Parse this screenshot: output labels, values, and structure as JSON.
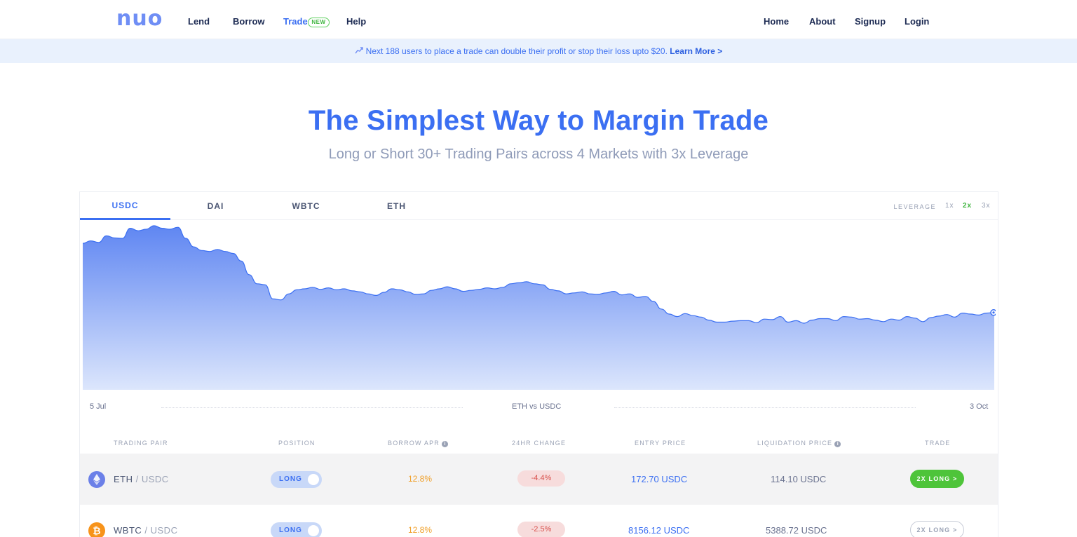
{
  "nav": {
    "logo": "nuo",
    "links": [
      "Lend",
      "Borrow",
      "Trade",
      "Help"
    ],
    "new_badge": "NEW",
    "right_links": [
      "Home",
      "About",
      "Signup",
      "Login"
    ]
  },
  "banner": {
    "icon": "rocket-icon",
    "text": "Next 188 users to place a trade can double their profit or stop their loss upto $20.",
    "link": "Learn More >"
  },
  "hero": {
    "title": "The Simplest Way to Margin Trade",
    "subtitle": "Long or Short 30+ Trading Pairs across 4 Markets with 3x Leverage"
  },
  "market": {
    "tabs": [
      "USDC",
      "DAI",
      "WBTC",
      "ETH"
    ],
    "active_tab": "USDC",
    "leverage_label": "LEVERAGE",
    "leverage_options": [
      "1x",
      "2x",
      "3x"
    ],
    "active_leverage": "2x"
  },
  "chart_data": {
    "type": "area",
    "title": "ETH vs USDC",
    "x_start_label": "5 Jul",
    "x_end_label": "3 Oct",
    "color": "#3b6ff2",
    "grid": false,
    "values": [
      290,
      295,
      292,
      305,
      301,
      300,
      320,
      315,
      318,
      325,
      320,
      318,
      322,
      300,
      283,
      276,
      274,
      278,
      274,
      270,
      255,
      228,
      210,
      208,
      180,
      178,
      190,
      198,
      200,
      203,
      199,
      202,
      198,
      200,
      196,
      194,
      190,
      187,
      193,
      200,
      198,
      194,
      189,
      190,
      197,
      200,
      204,
      200,
      195,
      197,
      199,
      202,
      200,
      203,
      210,
      212,
      214,
      210,
      208,
      199,
      196,
      190,
      192,
      194,
      190,
      189,
      192,
      195,
      188,
      190,
      183,
      185,
      175,
      160,
      150,
      145,
      151,
      147,
      144,
      138,
      134,
      134,
      136,
      137,
      137,
      133,
      140,
      139,
      145,
      134,
      137,
      132,
      138,
      141,
      141,
      137,
      145,
      144,
      140,
      141,
      138,
      135,
      140,
      138,
      145,
      142,
      135,
      143,
      146,
      149,
      144,
      152,
      150,
      148,
      152,
      153
    ]
  },
  "table": {
    "headers": [
      "TRADING PAIR",
      "POSITION",
      "BORROW APR",
      "24HR CHANGE",
      "ENTRY PRICE",
      "LIQUIDATION PRICE",
      "TRADE"
    ],
    "info_glyph": "i",
    "rows": [
      {
        "coin_icon": "ethereum-icon",
        "base": "ETH",
        "sep": " / ",
        "quote": "USDC",
        "position": "LONG",
        "apr": "12.8%",
        "change": "-4.4%",
        "entry": "172.70 USDC",
        "liq": "114.10 USDC",
        "trade": "2X LONG >",
        "trade_style": "filled"
      },
      {
        "coin_icon": "bitcoin-icon",
        "coin_glyph": "₿",
        "base": "WBTC",
        "sep": " / ",
        "quote": "USDC",
        "position": "LONG",
        "apr": "12.8%",
        "change": "-2.5%",
        "entry": "8156.12 USDC",
        "liq": "5388.72 USDC",
        "trade": "2X LONG >",
        "trade_style": "outline"
      }
    ]
  }
}
